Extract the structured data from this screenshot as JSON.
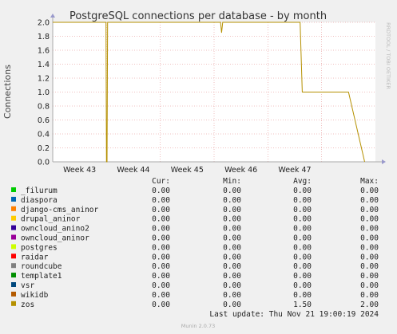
{
  "chart_data": {
    "type": "line",
    "title": "PostgreSQL connections per database - by month",
    "ylabel": "Connections",
    "xlabel": "",
    "ylim": [
      0,
      2.0
    ],
    "yticks": [
      "0.0",
      "0.2",
      "0.4",
      "0.6",
      "0.8",
      "1.0",
      "1.2",
      "1.4",
      "1.6",
      "1.8",
      "2.0"
    ],
    "xticks": [
      "Week 43",
      "Week 44",
      "Week 45",
      "Week 46",
      "Week 47"
    ],
    "grid": true,
    "x": [
      0,
      0.99,
      1.0,
      1.01,
      1.02,
      1.03,
      2.0,
      3.1,
      3.12,
      3.14,
      3.16,
      3.2,
      3.8,
      3.9,
      4.0,
      4.3,
      4.6,
      4.64,
      4.67,
      4.7,
      4.85,
      5.5,
      5.8
    ],
    "series": [
      {
        "name": "zos",
        "color": "#b59000",
        "values": [
          2.0,
          2.0,
          0.0,
          0.0,
          2.0,
          2.0,
          2.0,
          2.0,
          2.0,
          1.85,
          2.0,
          2.0,
          2.0,
          2.0,
          2.0,
          2.0,
          2.0,
          1.0,
          1.0,
          1.0,
          1.0,
          1.0,
          0.0
        ]
      }
    ],
    "legend": {
      "headers": [
        "Cur:",
        "Min:",
        "Avg:",
        "Max:"
      ],
      "rows": [
        {
          "name": "_filurum",
          "color": "#00cc00",
          "cur": "0.00",
          "min": "0.00",
          "avg": "0.00",
          "max": "0.00"
        },
        {
          "name": "diaspora",
          "color": "#0066b3",
          "cur": "0.00",
          "min": "0.00",
          "avg": "0.00",
          "max": "0.00"
        },
        {
          "name": "django-cms_aninor",
          "color": "#ff8000",
          "cur": "0.00",
          "min": "0.00",
          "avg": "0.00",
          "max": "0.00"
        },
        {
          "name": "drupal_aninor",
          "color": "#ffcc00",
          "cur": "0.00",
          "min": "0.00",
          "avg": "0.00",
          "max": "0.00"
        },
        {
          "name": "owncloud_anino2",
          "color": "#330099",
          "cur": "0.00",
          "min": "0.00",
          "avg": "0.00",
          "max": "0.00"
        },
        {
          "name": "owncloud_aninor",
          "color": "#990099",
          "cur": "0.00",
          "min": "0.00",
          "avg": "0.00",
          "max": "0.00"
        },
        {
          "name": "postgres",
          "color": "#ccff00",
          "cur": "0.00",
          "min": "0.00",
          "avg": "0.00",
          "max": "0.00"
        },
        {
          "name": "raidar",
          "color": "#ff0000",
          "cur": "0.00",
          "min": "0.00",
          "avg": "0.00",
          "max": "0.00"
        },
        {
          "name": "roundcube",
          "color": "#808080",
          "cur": "0.00",
          "min": "0.00",
          "avg": "0.00",
          "max": "0.00"
        },
        {
          "name": "template1",
          "color": "#008f00",
          "cur": "0.00",
          "min": "0.00",
          "avg": "0.00",
          "max": "0.00"
        },
        {
          "name": "vsr",
          "color": "#00487d",
          "cur": "0.00",
          "min": "0.00",
          "avg": "0.00",
          "max": "0.00"
        },
        {
          "name": "wikidb",
          "color": "#b35a00",
          "cur": "0.00",
          "min": "0.00",
          "avg": "0.00",
          "max": "0.00"
        },
        {
          "name": "zos",
          "color": "#b59000",
          "cur": "0.00",
          "min": "0.00",
          "avg": "1.50",
          "max": "2.00"
        }
      ]
    },
    "last_update": "Last update: Thu Nov 21 19:00:19 2024",
    "footer": "Munin 2.0.73",
    "watermark": "RRDTOOL / TOBI OETIKER"
  },
  "colors": {
    "background": "#f0f0f0",
    "plot_area": "#ffffff",
    "grid": "#e08080",
    "axis": "#aaaaaa"
  }
}
